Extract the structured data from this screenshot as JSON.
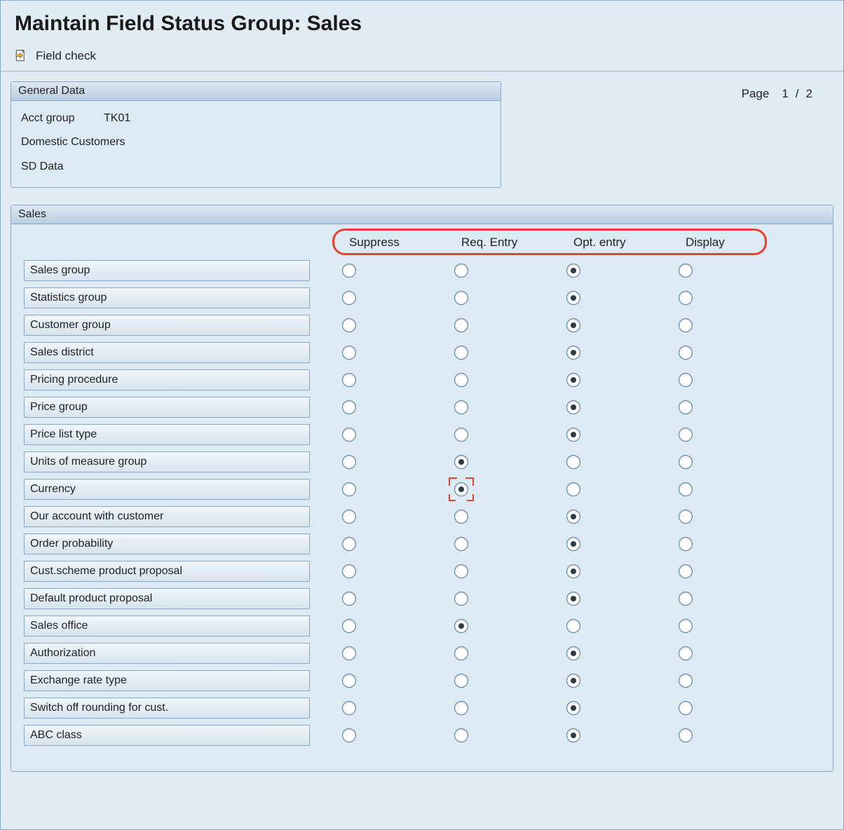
{
  "title": "Maintain Field Status Group: Sales",
  "toolbar": {
    "field_check_label": "Field check"
  },
  "general_data": {
    "panel_title": "General Data",
    "acct_group_label": "Acct group",
    "acct_group_value": "TK01",
    "customer_desc": "Domestic Customers",
    "sd_data": "SD Data"
  },
  "pagination": {
    "label": "Page",
    "current": "1",
    "sep": "/",
    "total": "2"
  },
  "sales": {
    "panel_title": "Sales",
    "columns": [
      "Suppress",
      "Req. Entry",
      "Opt. entry",
      "Display"
    ],
    "focus_row_index": 8,
    "focus_col_index": 1,
    "rows": [
      {
        "label": "Sales group",
        "selected": 2
      },
      {
        "label": "Statistics group",
        "selected": 2
      },
      {
        "label": "Customer group",
        "selected": 2
      },
      {
        "label": "Sales district",
        "selected": 2
      },
      {
        "label": "Pricing procedure",
        "selected": 2
      },
      {
        "label": "Price group",
        "selected": 2
      },
      {
        "label": "Price list type",
        "selected": 2
      },
      {
        "label": "Units of measure group",
        "selected": 1
      },
      {
        "label": "Currency",
        "selected": 1
      },
      {
        "label": "Our account with customer",
        "selected": 2
      },
      {
        "label": "Order probability",
        "selected": 2
      },
      {
        "label": "Cust.scheme product proposal",
        "selected": 2
      },
      {
        "label": "Default product proposal",
        "selected": 2
      },
      {
        "label": "Sales office",
        "selected": 1
      },
      {
        "label": "Authorization",
        "selected": 2
      },
      {
        "label": "Exchange rate type",
        "selected": 2
      },
      {
        "label": "Switch off rounding for cust.",
        "selected": 2
      },
      {
        "label": "ABC class",
        "selected": 2
      }
    ]
  }
}
